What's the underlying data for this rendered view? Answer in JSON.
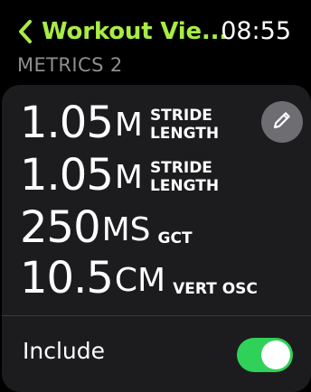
{
  "header": {
    "back_label": "Workout Vie...",
    "time": "08:55"
  },
  "section_title": "METRICS 2",
  "metrics": [
    {
      "value": "1.05",
      "unit": "M",
      "label_line1": "STRIDE",
      "label_line2": "LENGTH"
    },
    {
      "value": "1.05",
      "unit": "M",
      "label_line1": "STRIDE",
      "label_line2": "LENGTH"
    },
    {
      "value": "250",
      "unit": "MS",
      "label_line1": "GCT",
      "label_line2": ""
    },
    {
      "value": "10.5",
      "unit": "CM",
      "label_line1": "VERT OSC",
      "label_line2": ""
    }
  ],
  "edit_icon": "pencil-icon",
  "include": {
    "label": "Include",
    "enabled": true
  },
  "colors": {
    "accent": "#a8ec46",
    "toggle_on": "#30d158",
    "card_bg": "#1c1c1e",
    "secondary_text": "#8e8e93"
  }
}
